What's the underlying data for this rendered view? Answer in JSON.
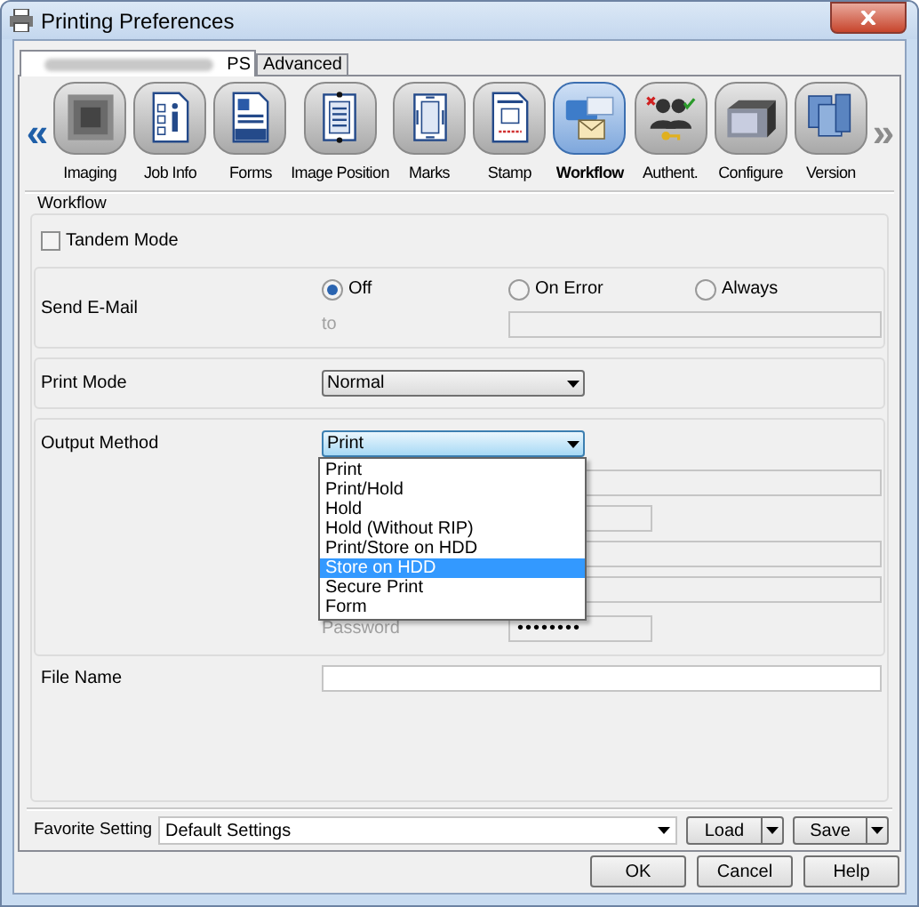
{
  "window": {
    "title": "Printing Preferences"
  },
  "tabs": [
    {
      "label": "PS",
      "selected": true
    },
    {
      "label": "Advanced",
      "selected": false
    }
  ],
  "nav_prev": {
    "label": "«",
    "disabled": false
  },
  "nav_next": {
    "label": "»",
    "disabled": true
  },
  "categories": [
    {
      "label": "Imaging",
      "selected": false
    },
    {
      "label": "Job Info",
      "selected": false
    },
    {
      "label": "Forms",
      "selected": false
    },
    {
      "label": "Image Position",
      "selected": false
    },
    {
      "label": "Marks",
      "selected": false
    },
    {
      "label": "Stamp",
      "selected": false
    },
    {
      "label": "Workflow",
      "selected": true
    },
    {
      "label": "Authent.",
      "selected": false
    },
    {
      "label": "Configure",
      "selected": false
    },
    {
      "label": "Version",
      "selected": false
    }
  ],
  "workflow": {
    "title": "Workflow",
    "tandem_mode": {
      "label": "Tandem Mode",
      "checked": false
    },
    "send_email": {
      "label": "Send E-Mail",
      "options": [
        {
          "label": "Off",
          "selected": true
        },
        {
          "label": "On Error",
          "selected": false
        },
        {
          "label": "Always",
          "selected": false
        }
      ],
      "to_label": "to",
      "to_disabled": true
    },
    "print_mode": {
      "label": "Print Mode",
      "value": "Normal"
    },
    "output_method": {
      "label": "Output Method",
      "value": "Print",
      "expanded": true,
      "options": [
        {
          "label": "Print",
          "highlighted": false
        },
        {
          "label": "Print/Hold",
          "highlighted": false
        },
        {
          "label": "Hold",
          "highlighted": false
        },
        {
          "label": "Hold (Without RIP)",
          "highlighted": false
        },
        {
          "label": "Print/Store on HDD",
          "highlighted": false
        },
        {
          "label": "Store on HDD",
          "highlighted": true
        },
        {
          "label": "Secure Print",
          "highlighted": false
        },
        {
          "label": "Form",
          "highlighted": false
        }
      ],
      "password_label": "Password",
      "password_value": "••••••••",
      "password_disabled": true
    },
    "file_name": {
      "label": "File Name"
    }
  },
  "favorite": {
    "label": "Favorite Setting",
    "value": "Default Settings",
    "load": "Load",
    "save": "Save"
  },
  "buttons": [
    "OK",
    "Cancel",
    "Help"
  ]
}
